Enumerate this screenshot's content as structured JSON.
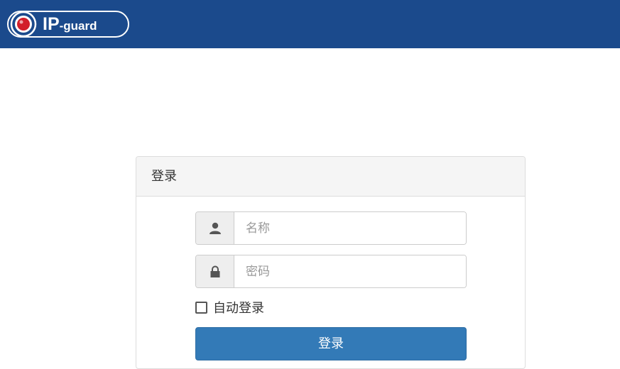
{
  "header": {
    "logo_main": "IP",
    "logo_suffix": "-guard",
    "background": "#1b4a8c"
  },
  "login_panel": {
    "title": "登录",
    "username": {
      "icon": "user-icon",
      "placeholder": "名称",
      "value": ""
    },
    "password": {
      "icon": "lock-icon",
      "placeholder": "密码",
      "value": ""
    },
    "auto_login": {
      "label": "自动登录",
      "checked": false
    },
    "submit_label": "登录",
    "button_color": "#337ab7"
  }
}
